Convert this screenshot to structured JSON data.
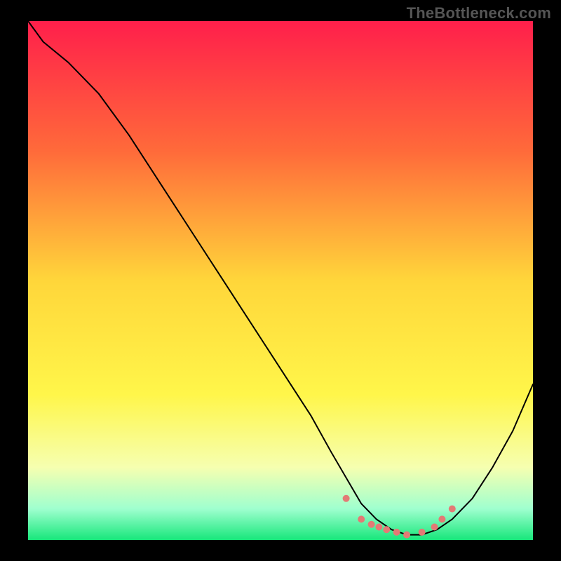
{
  "watermark": "TheBottleneck.com",
  "chart_data": {
    "type": "line",
    "title": "",
    "xlabel": "",
    "ylabel": "",
    "xlim": [
      0,
      100
    ],
    "ylim": [
      0,
      100
    ],
    "grid": false,
    "legend": false,
    "background_gradient": {
      "stops": [
        {
          "offset": 0.0,
          "color": "#ff1f4b"
        },
        {
          "offset": 0.25,
          "color": "#ff6a3a"
        },
        {
          "offset": 0.5,
          "color": "#ffd63a"
        },
        {
          "offset": 0.72,
          "color": "#fff64a"
        },
        {
          "offset": 0.86,
          "color": "#f6ffb0"
        },
        {
          "offset": 0.94,
          "color": "#9fffcf"
        },
        {
          "offset": 1.0,
          "color": "#17e77b"
        }
      ]
    },
    "series": [
      {
        "name": "bottleneck-curve",
        "color": "#000000",
        "width": 2,
        "x": [
          0,
          3,
          8,
          14,
          20,
          26,
          32,
          38,
          44,
          50,
          56,
          60,
          63,
          66,
          69,
          72,
          75,
          78,
          81,
          84,
          88,
          92,
          96,
          100
        ],
        "y": [
          100,
          96,
          92,
          86,
          78,
          69,
          60,
          51,
          42,
          33,
          24,
          17,
          12,
          7,
          4,
          2,
          1,
          1,
          2,
          4,
          8,
          14,
          21,
          30
        ]
      }
    ],
    "marker_series": [
      {
        "name": "optimal-zone-dots",
        "color": "#e37a75",
        "radius": 5,
        "x": [
          63,
          66,
          68,
          69.5,
          71,
          73,
          75,
          78,
          80.5,
          82,
          84
        ],
        "y": [
          8,
          4,
          3,
          2.5,
          2,
          1.5,
          1,
          1.5,
          2.5,
          4,
          6
        ]
      }
    ]
  }
}
